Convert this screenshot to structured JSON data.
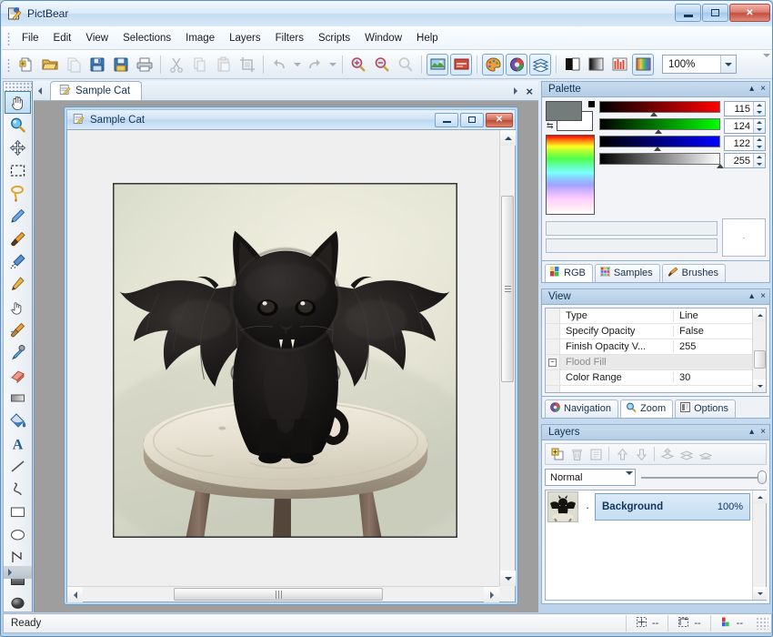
{
  "window": {
    "title": "PictBear",
    "app_icon": "pictbear-icon",
    "buttons": {
      "minimize": "minimize",
      "maximize": "maximize",
      "close": "close"
    }
  },
  "menubar": {
    "items": [
      {
        "label": "File",
        "accel": "F"
      },
      {
        "label": "Edit",
        "accel": "E"
      },
      {
        "label": "View",
        "accel": "V"
      },
      {
        "label": "Selections",
        "accel": "S"
      },
      {
        "label": "Image",
        "accel": "I"
      },
      {
        "label": "Layers",
        "accel": "L"
      },
      {
        "label": "Filters",
        "accel": "t"
      },
      {
        "label": "Scripts",
        "accel": "c"
      },
      {
        "label": "Window",
        "accel": "W"
      },
      {
        "label": "Help",
        "accel": "H"
      }
    ]
  },
  "toolbar": {
    "buttons": [
      {
        "name": "new-icon",
        "enabled": true
      },
      {
        "name": "open-icon",
        "enabled": true
      },
      {
        "name": "duplicate-icon",
        "enabled": false
      },
      {
        "name": "save-icon",
        "enabled": true
      },
      {
        "name": "save-as-icon",
        "enabled": true
      },
      {
        "name": "print-icon",
        "enabled": true
      },
      {
        "name": "cut-icon",
        "enabled": false
      },
      {
        "name": "copy-icon",
        "enabled": false
      },
      {
        "name": "paste-icon",
        "enabled": false
      },
      {
        "name": "crop-icon",
        "enabled": false
      },
      {
        "name": "undo-icon",
        "enabled": false
      },
      {
        "name": "redo-icon",
        "enabled": false
      },
      {
        "name": "zoom-in-icon",
        "enabled": true
      },
      {
        "name": "zoom-out-icon",
        "enabled": true
      },
      {
        "name": "zoom-actual-icon",
        "enabled": false
      },
      {
        "name": "image-size-icon",
        "enabled": true
      },
      {
        "name": "canvas-size-icon",
        "enabled": true
      },
      {
        "name": "palette-window-icon",
        "enabled": true
      },
      {
        "name": "color-wheel-icon",
        "enabled": true
      },
      {
        "name": "layers-window-icon",
        "enabled": true
      },
      {
        "name": "brightness-icon",
        "enabled": true
      },
      {
        "name": "contrast-icon",
        "enabled": true
      },
      {
        "name": "levels-icon",
        "enabled": true
      },
      {
        "name": "hue-saturation-icon",
        "enabled": true
      }
    ],
    "zoom_value": "100%"
  },
  "toolpalette": {
    "tools": [
      {
        "name": "hand-tool",
        "label": "Hand",
        "active": true
      },
      {
        "name": "magnifier-tool",
        "label": "Zoom",
        "active": false
      },
      {
        "name": "move-tool",
        "label": "Move",
        "active": false
      },
      {
        "name": "rect-select-tool",
        "label": "Rectangle Select",
        "active": false
      },
      {
        "name": "lasso-tool",
        "label": "Lasso",
        "active": false
      },
      {
        "name": "pen-tool",
        "label": "Pen",
        "active": false
      },
      {
        "name": "brush-tool",
        "label": "Brush",
        "active": false
      },
      {
        "name": "airbrush-tool",
        "label": "Airbrush",
        "active": false
      },
      {
        "name": "pencil-tool",
        "label": "Pencil",
        "active": false
      },
      {
        "name": "finger-tool",
        "label": "Smudge",
        "active": false
      },
      {
        "name": "blur-tool",
        "label": "Blur",
        "active": false
      },
      {
        "name": "eyedropper-tool",
        "label": "Eyedropper",
        "active": false
      },
      {
        "name": "eraser-tool",
        "label": "Eraser",
        "active": false
      },
      {
        "name": "gradient-tool",
        "label": "Gradient",
        "active": false
      },
      {
        "name": "bucket-fill-tool",
        "label": "Flood Fill",
        "active": false
      },
      {
        "name": "text-tool",
        "label": "Text",
        "active": false
      },
      {
        "name": "line-tool",
        "label": "Line",
        "active": false
      },
      {
        "name": "curve-tool",
        "label": "Curve",
        "active": false
      },
      {
        "name": "rectangle-tool",
        "label": "Rectangle",
        "active": false
      },
      {
        "name": "ellipse-tool",
        "label": "Ellipse",
        "active": false
      },
      {
        "name": "polygon-tool",
        "label": "Polygon",
        "active": false
      },
      {
        "name": "filled-rectangle-tool",
        "label": "Filled Rectangle",
        "active": false
      },
      {
        "name": "filled-ellipse-tool",
        "label": "Filled Ellipse",
        "active": false
      },
      {
        "name": "filled-polygon-tool",
        "label": "Filled Polygon",
        "active": false
      }
    ]
  },
  "document": {
    "tab_label": "Sample Cat",
    "tab_icon": "document-icon",
    "window_title": "Sample Cat",
    "close_label": "×"
  },
  "palette_panel": {
    "title": "Palette",
    "collapse_label": "▴",
    "close_label": "×",
    "foreground_color": "#737C7A",
    "background_color": "#FFFFFF",
    "channels": [
      {
        "name": "R",
        "value": "115"
      },
      {
        "name": "G",
        "value": "124"
      },
      {
        "name": "B",
        "value": "122"
      },
      {
        "name": "A",
        "value": "255"
      }
    ],
    "tabs": [
      {
        "label": "RGB",
        "icon": "rgb-icon",
        "active": true
      },
      {
        "label": "Samples",
        "icon": "samples-icon",
        "active": false
      },
      {
        "label": "Brushes",
        "icon": "brushes-icon",
        "active": false
      }
    ]
  },
  "view_panel": {
    "title": "View",
    "collapse_label": "▴",
    "close_label": "×",
    "properties": [
      {
        "name": "Type",
        "value": "Line",
        "category": false
      },
      {
        "name": "Specify Opacity",
        "value": "False",
        "category": false
      },
      {
        "name": "Finish Opacity V...",
        "value": "255",
        "category": false
      },
      {
        "name": "Flood Fill",
        "value": "",
        "category": true
      },
      {
        "name": "Color Range",
        "value": "30",
        "category": false
      }
    ],
    "tabs": [
      {
        "label": "Navigation",
        "icon": "navigation-icon",
        "active": false
      },
      {
        "label": "Zoom",
        "icon": "zoom-icon",
        "active": true
      },
      {
        "label": "Options",
        "icon": "options-icon",
        "active": false
      }
    ]
  },
  "layers_panel": {
    "title": "Layers",
    "collapse_label": "▴",
    "close_label": "×",
    "toolbar_buttons": [
      {
        "name": "add-layer-icon",
        "enabled": true
      },
      {
        "name": "delete-layer-icon",
        "enabled": false
      },
      {
        "name": "layer-properties-icon",
        "enabled": false
      },
      {
        "name": "move-layer-up-icon",
        "enabled": false
      },
      {
        "name": "move-layer-down-icon",
        "enabled": false
      },
      {
        "name": "merge-down-icon",
        "enabled": false
      },
      {
        "name": "merge-visible-icon",
        "enabled": false
      },
      {
        "name": "flatten-image-icon",
        "enabled": false
      }
    ],
    "blend_mode": "Normal",
    "opacity_percent": 100,
    "layers": [
      {
        "name": "Background",
        "opacity": "100%",
        "visible": true,
        "selected": true
      }
    ]
  },
  "statusbar": {
    "message": "Ready",
    "panes": [
      {
        "icon": "cursor-position-icon",
        "value": "--"
      },
      {
        "icon": "selection-size-icon",
        "value": "--"
      },
      {
        "icon": "color-value-icon",
        "value": "--"
      }
    ]
  }
}
